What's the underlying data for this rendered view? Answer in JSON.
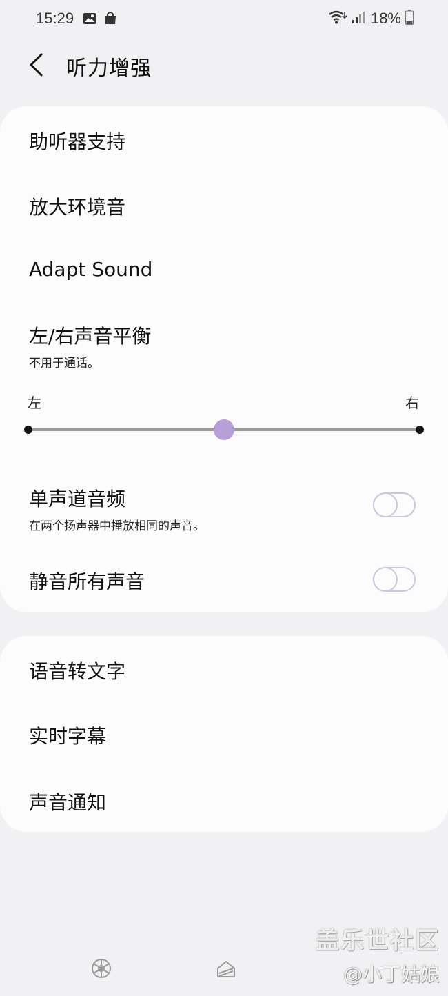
{
  "status_bar": {
    "time": "15:29",
    "battery": "18%"
  },
  "header": {
    "title": "听力增强"
  },
  "card1": {
    "hearing_aid": "助听器支持",
    "amplify_ambient": "放大环境音",
    "adapt_sound": "Adapt Sound",
    "balance_title": "左/右声音平衡",
    "balance_sub": "不用于通话。",
    "balance_left": "左",
    "balance_right": "右",
    "balance_value": 0.5,
    "mono_title": "单声道音频",
    "mono_sub": "在两个扬声器中播放相同的声音。",
    "mono_enabled": false,
    "mute_all": "静音所有声音",
    "mute_enabled": false
  },
  "card2": {
    "speech_to_text": "语音转文字",
    "live_caption": "实时字幕",
    "sound_notification": "声音通知"
  },
  "watermark": {
    "line1": "盖乐世社区",
    "line2": "@小丁姑娘"
  },
  "colors": {
    "background": "#f1f1f3",
    "card": "#fcfcfc",
    "accent": "#b6a0d6"
  }
}
